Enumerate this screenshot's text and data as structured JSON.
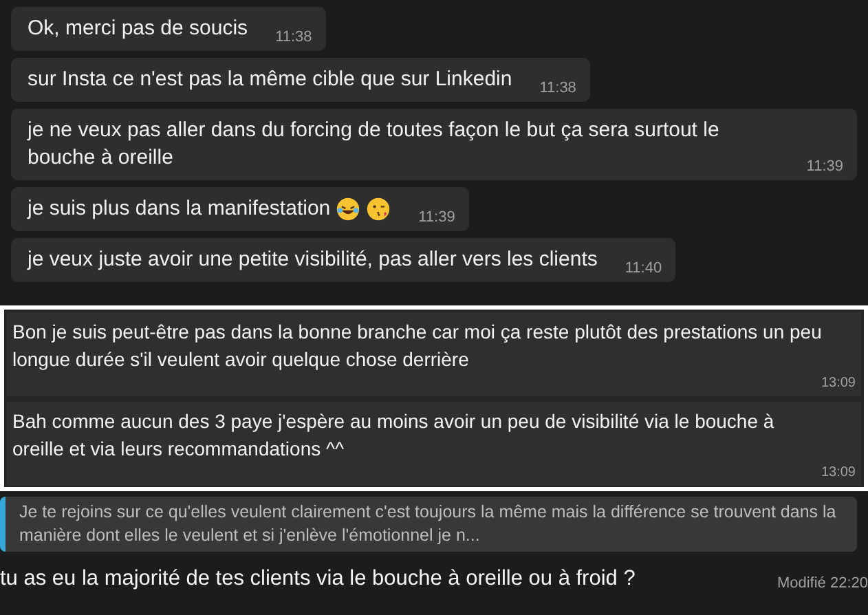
{
  "chat_messages": [
    {
      "text": "Ok, merci pas de soucis",
      "time": "11:38"
    },
    {
      "text": "sur Insta ce n'est pas la même cible que sur Linkedin",
      "time": "11:38"
    },
    {
      "text": "je ne veux pas aller dans du forcing de toutes façon le but ça sera surtout le bouche à oreille",
      "time": "11:39"
    },
    {
      "text": "je suis plus dans la manifestation",
      "time": "11:39",
      "icons": [
        {
          "kind": "laughing"
        },
        {
          "kind": "kissing"
        }
      ]
    },
    {
      "text": "je veux juste avoir une petite visibilité, pas aller vers les clients",
      "time": "11:40"
    }
  ],
  "framed_messages": [
    {
      "text": "Bon je suis peut-être pas dans la bonne branche car moi ça reste plutôt des prestations un peu longue durée s'il veulent avoir quelque chose derrière",
      "time": "13:09"
    },
    {
      "text": "Bah comme aucun des 3 paye j'espère au moins avoir un peu de visibilité via le bouche à oreille et via leurs recommandations ^^",
      "time": "13:09"
    }
  ],
  "reply": {
    "quote": "Je te rejoins sur ce qu'elles veulent clairement c'est toujours la même mais la différence se trouvent dans la manière dont elles le veulent et si j'enlève l'émotionnel je n...",
    "text": "tu as eu la majorité de tes clients via le bouche à oreille ou à froid ?",
    "status": "Modifié 22:20"
  }
}
